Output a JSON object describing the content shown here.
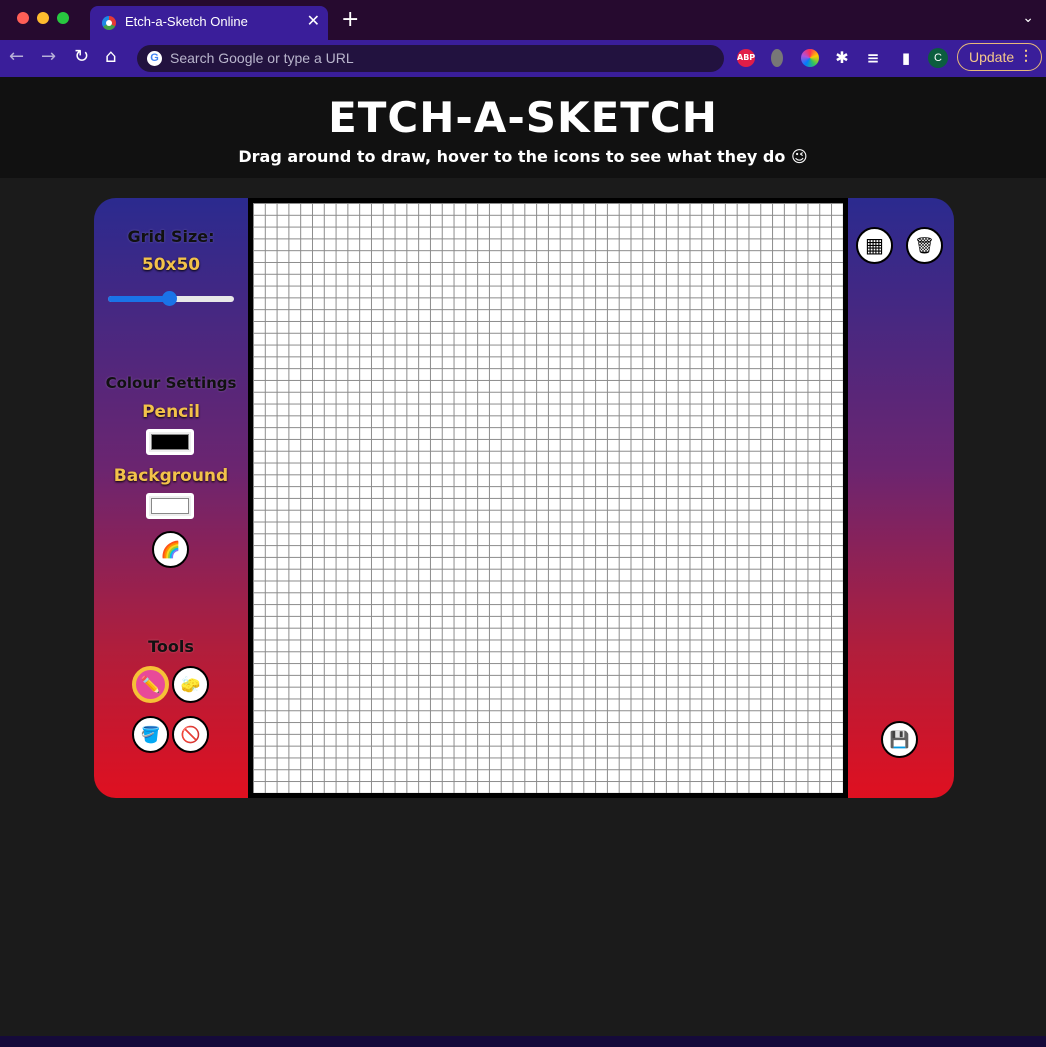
{
  "browser": {
    "tab_title": "Etch-a-Sketch Online",
    "tab_close": "✕",
    "new_tab": "+",
    "tab_menu": "⌄",
    "omnibox_placeholder": "Search Google or type a URL",
    "google_letter": "G",
    "nav": {
      "back": "←",
      "forward": "→",
      "reload": "↻",
      "home": "⌂"
    },
    "extensions": {
      "abp": "ABP",
      "puzzle": "✱",
      "list": "≡",
      "sidepanel": "▮"
    },
    "profile_initial": "C",
    "update_label": "Update",
    "menu": "⋮"
  },
  "header": {
    "title": "ETCH-A-SKETCH",
    "subtitle": "Drag around to draw, hover to the icons to see what they do 😉"
  },
  "left_panel": {
    "grid_size_label": "Grid Size:",
    "grid_size_value": "50x50",
    "grid_slider": {
      "min": 1,
      "max": 100,
      "value": 50
    },
    "colour_settings_label": "Colour Settings",
    "pencil_label": "Pencil",
    "pencil_color": "#000000",
    "background_label": "Background",
    "background_color": "#ffffff",
    "rainbow_icon": "🌈",
    "tools_label": "Tools",
    "tools": {
      "pencil_icon": "✏️",
      "eraser_icon": "🧽",
      "fill_icon": "🪣",
      "clear_icon": "🚫"
    }
  },
  "right_panel": {
    "grid_toggle_icon": "▦",
    "trash_icon": "🗑",
    "save_icon": "💾"
  },
  "canvas": {
    "rows": 50,
    "cols": 50,
    "grid_lines": true
  }
}
